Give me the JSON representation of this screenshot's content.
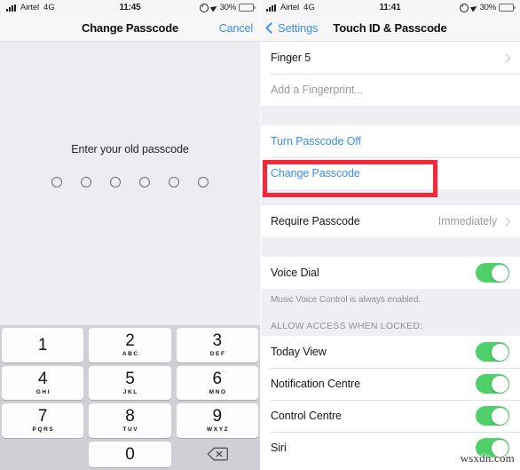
{
  "left": {
    "status_bar": {
      "signal_icon": "signal-bars-icon",
      "carrier": "Airtel",
      "network": "4G",
      "time": "11:45",
      "alarm_icon": "alarm-clock-icon",
      "location_icon": "location-arrow-icon",
      "battery_percent": "30%",
      "battery_icon": "battery-icon"
    },
    "nav": {
      "title": "Change Passcode",
      "cancel_label": "Cancel"
    },
    "passcode": {
      "prompt": "Enter your old passcode",
      "dot_count": 6,
      "filled_count": 0
    },
    "keypad": {
      "keys": [
        {
          "num": "1",
          "letters": ""
        },
        {
          "num": "2",
          "letters": "ABC"
        },
        {
          "num": "3",
          "letters": "DEF"
        },
        {
          "num": "4",
          "letters": "GHI"
        },
        {
          "num": "5",
          "letters": "JKL"
        },
        {
          "num": "6",
          "letters": "MNO"
        },
        {
          "num": "7",
          "letters": "PQRS"
        },
        {
          "num": "8",
          "letters": "TUV"
        },
        {
          "num": "9",
          "letters": "WXYZ"
        },
        {
          "num": "0",
          "letters": ""
        }
      ],
      "delete_icon": "delete-backspace-icon"
    }
  },
  "right": {
    "status_bar": {
      "signal_icon": "signal-bars-icon",
      "carrier": "Airtel",
      "network": "4G",
      "time": "11:41",
      "alarm_icon": "alarm-clock-icon",
      "location_icon": "location-arrow-icon",
      "battery_percent": "30%",
      "battery_icon": "battery-icon"
    },
    "nav": {
      "back_label": "Settings",
      "title": "Touch ID & Passcode"
    },
    "fingerprints": {
      "finger_row": "Finger 5",
      "add_row": "Add a Fingerprint..."
    },
    "passcode_group": {
      "turn_off": "Turn Passcode Off",
      "change": "Change Passcode"
    },
    "require": {
      "label": "Require Passcode",
      "value": "Immediately"
    },
    "voice_dial": {
      "label": "Voice Dial",
      "on": true,
      "footnote": "Music Voice Control is always enabled."
    },
    "allow_access": {
      "header": "ALLOW ACCESS WHEN LOCKED:",
      "items": [
        {
          "label": "Today View",
          "on": true
        },
        {
          "label": "Notification Centre",
          "on": true
        },
        {
          "label": "Control Centre",
          "on": true
        },
        {
          "label": "Siri",
          "on": true
        }
      ]
    }
  },
  "annotation": {
    "highlight_color": "#f5283c",
    "highlight_target": "Change Passcode"
  },
  "watermark": "wsxdn.com",
  "colors": {
    "accent_blue": "#3b8ef0",
    "toggle_green": "#4fd06a",
    "list_bg": "#efeef3",
    "keypad_bg": "#cfcfd6"
  }
}
